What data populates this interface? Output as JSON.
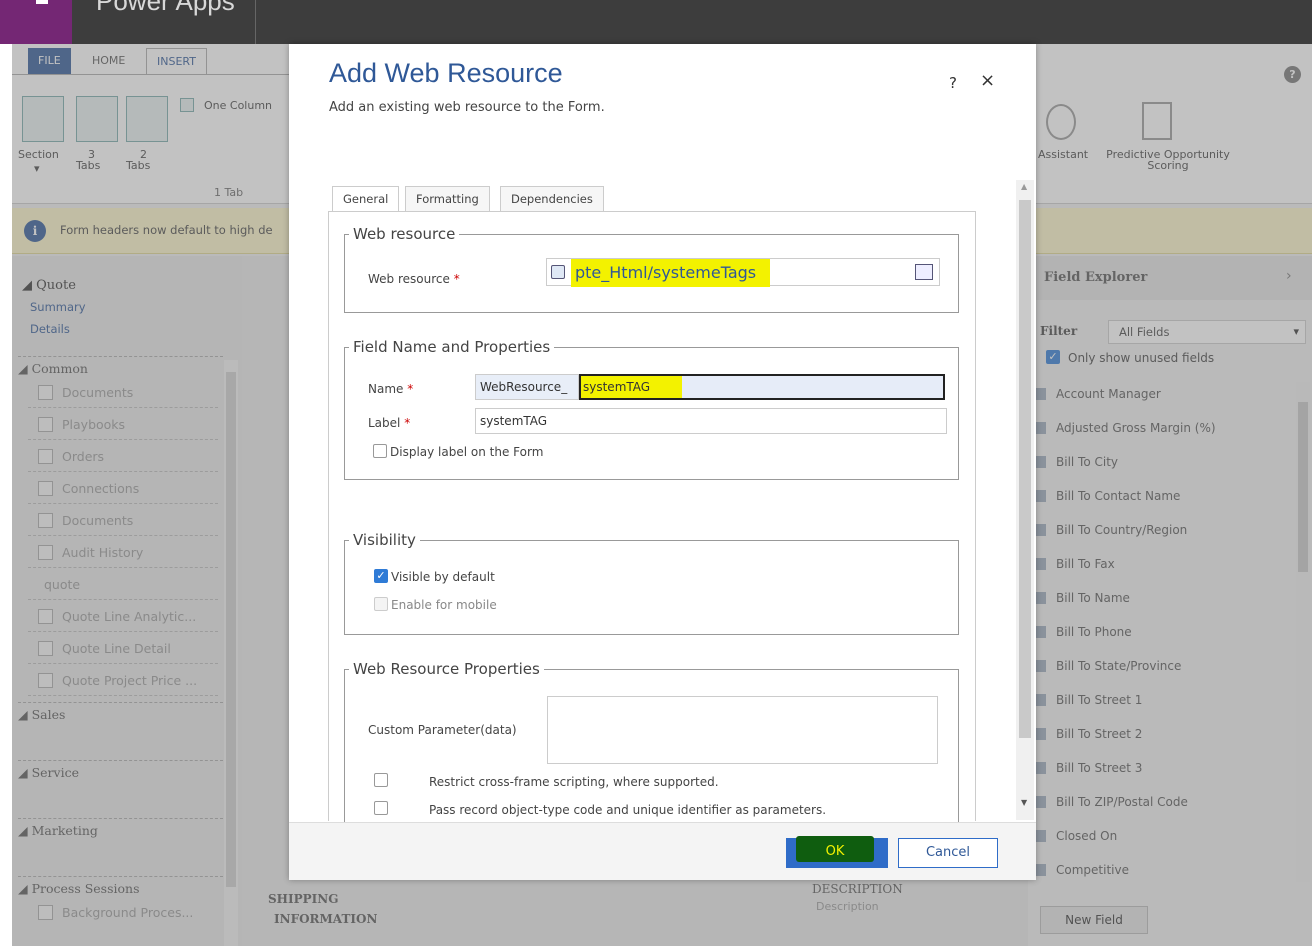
{
  "app": {
    "title": "Power Apps"
  },
  "ribbon": {
    "tabs": [
      "FILE",
      "HOME",
      "INSERT"
    ],
    "one_column": "One Column",
    "section": "Section",
    "three_tabs_num": "3",
    "three_tabs": "Tabs",
    "two_tabs_num": "2",
    "two_tabs": "Tabs",
    "one_tab": "1 Tab",
    "assistant": "Assistant",
    "predictive_1": "Predictive Opportunity",
    "predictive_2": "Scoring",
    "help": "?"
  },
  "banner": {
    "text": "Form headers now default to high de"
  },
  "leftnav": {
    "entity": "Quote",
    "links": [
      "Summary",
      "Details"
    ],
    "common": "Common",
    "items": [
      "Documents",
      "Playbooks",
      "Orders",
      "Connections",
      "Documents",
      "Audit History",
      "quote",
      "Quote Line Analytic...",
      "Quote Line Detail",
      "Quote Project Price ..."
    ],
    "sections": [
      "Sales",
      "Service",
      "Marketing",
      "Process Sessions"
    ],
    "bottom_item": "Background Proces..."
  },
  "canvas": {
    "shipping_1": "SHIPPING",
    "shipping_2": "INFORMATION",
    "description": "DESCRIPTION",
    "description_ph": "Description"
  },
  "field_explorer": {
    "title": "Field Explorer",
    "filter_label": "Filter",
    "filter_value": "All Fields",
    "only_unused": "Only show unused fields",
    "fields": [
      "Account Manager",
      "Adjusted Gross Margin (%)",
      "Bill To City",
      "Bill To Contact Name",
      "Bill To Country/Region",
      "Bill To Fax",
      "Bill To Name",
      "Bill To Phone",
      "Bill To State/Province",
      "Bill To Street 1",
      "Bill To Street 2",
      "Bill To Street 3",
      "Bill To ZIP/Postal Code",
      "Closed On",
      "Competitive"
    ],
    "new_field": "New Field"
  },
  "dialog": {
    "title": "Add Web Resource",
    "subtitle": "Add an existing web resource to the Form.",
    "help": "?",
    "close": "×",
    "tabs": [
      "General",
      "Formatting",
      "Dependencies"
    ],
    "web_resource_section": "Web resource",
    "web_resource_label": "Web resource",
    "web_resource_value": "pte_Html/systemeTags",
    "field_section": "Field Name and Properties",
    "name_label": "Name",
    "name_prefix": "WebResource_",
    "name_value": "systemTAG",
    "label_label": "Label",
    "label_value": "systemTAG",
    "display_label": "Display label on the Form",
    "visibility_section": "Visibility",
    "visible_default": "Visible by default",
    "enable_mobile": "Enable for mobile",
    "props_section": "Web Resource Properties",
    "custom_param": "Custom Parameter(data)",
    "restrict": "Restrict cross-frame scripting, where supported.",
    "pass_record": "Pass record object-type code and unique identifier as parameters.",
    "ok": "OK",
    "cancel": "Cancel"
  },
  "colors": {
    "accent": "#2f5897",
    "ok_button": "#2f6cc8",
    "highlight": "#f3f200",
    "brand": "#742774"
  }
}
